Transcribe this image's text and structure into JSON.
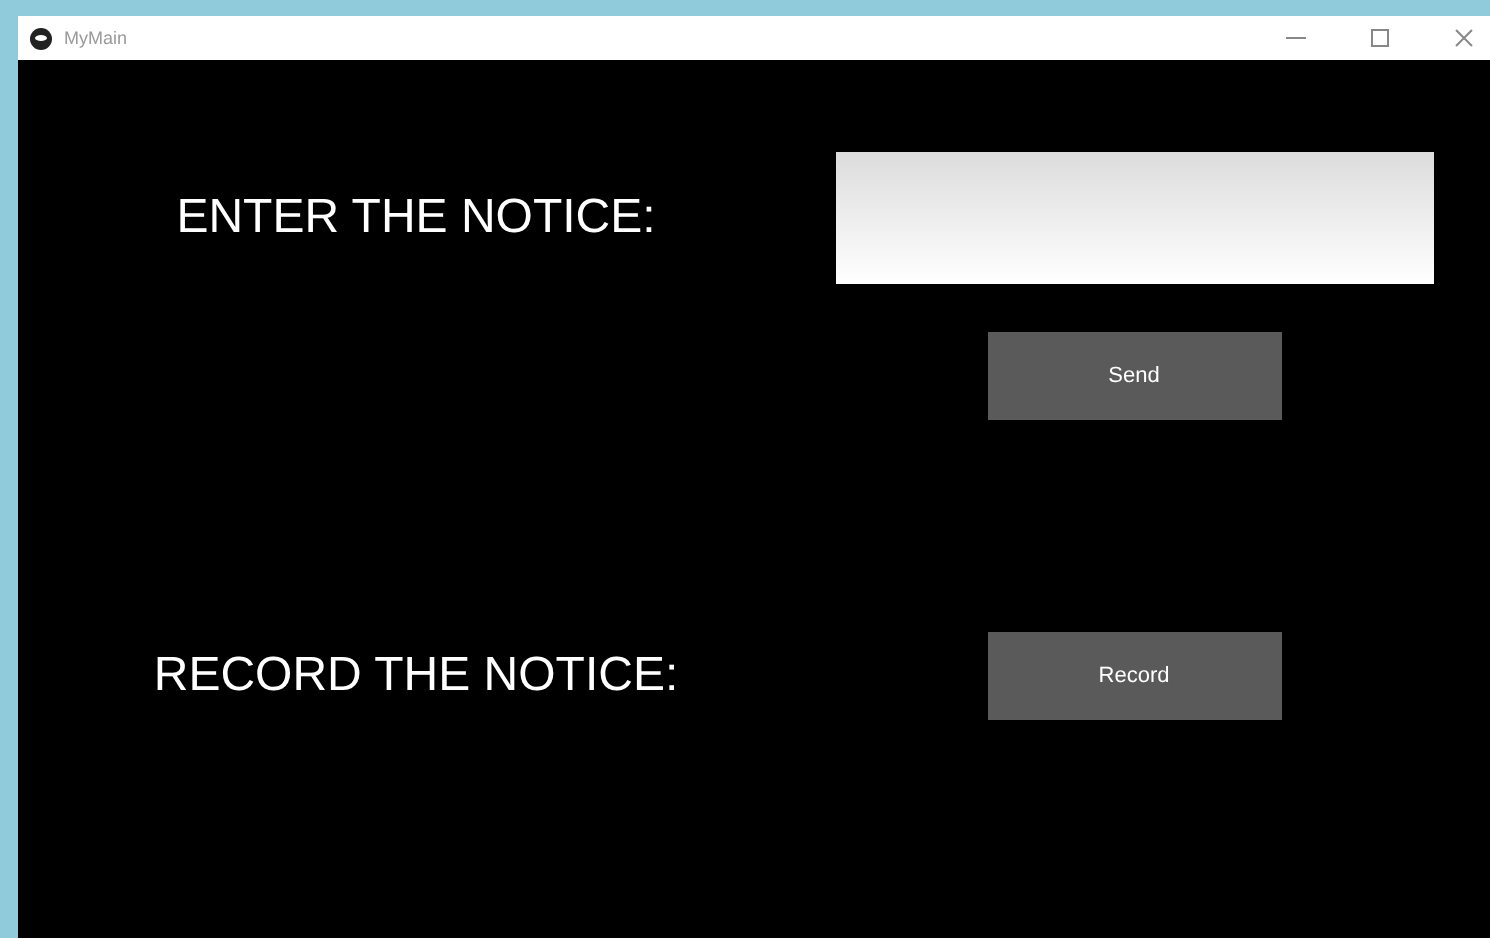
{
  "window": {
    "title": "MyMain"
  },
  "notice_entry": {
    "label": "ENTER THE NOTICE:"
  },
  "buttons": [
    {
      "label": "Send"
    },
    {
      "label": "Record"
    }
  ],
  "record": {
    "label": "RECORD THE NOTICE:"
  }
}
